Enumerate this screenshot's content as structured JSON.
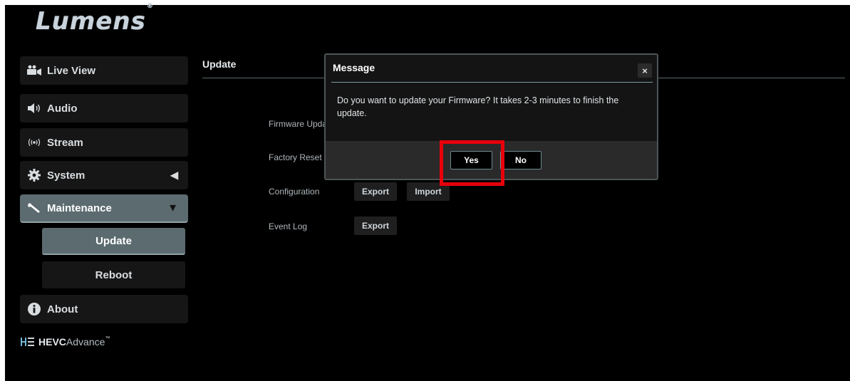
{
  "brand": {
    "logo_text": "Lumens",
    "logo_mark": "®"
  },
  "sidebar": {
    "items": [
      {
        "label": "Live View",
        "icon": "video-camera-icon"
      },
      {
        "label": "Audio",
        "icon": "speaker-icon"
      },
      {
        "label": "Stream",
        "icon": "broadcast-icon"
      },
      {
        "label": "System",
        "icon": "gear-icon",
        "arrow": "◀"
      },
      {
        "label": "Maintenance",
        "icon": "wrench-icon",
        "arrow": "▼"
      },
      {
        "label": "About",
        "icon": "info-icon"
      }
    ],
    "sub_items": [
      {
        "label": "Update",
        "active": true
      },
      {
        "label": "Reboot",
        "active": false
      }
    ],
    "partner_logo": {
      "prefix": "HEVC",
      "suffix": "Advance",
      "tm": "™"
    }
  },
  "content": {
    "title": "Update",
    "rows": [
      {
        "label": "Firmware Update"
      },
      {
        "label": "Factory Reset"
      },
      {
        "label": "Configuration",
        "buttons": [
          "Export",
          "Import"
        ]
      },
      {
        "label": "Event Log",
        "buttons": [
          "Export"
        ]
      }
    ]
  },
  "dialog": {
    "title": "Message",
    "close_glyph": "×",
    "message": "Do you want to update your Firmware? It takes 2-3 minutes to finish the update.",
    "yes_label": "Yes",
    "no_label": "No"
  },
  "annotation": {
    "highlight_color": "#e8000b",
    "target": "Yes"
  },
  "colors": {
    "active_nav": "#5c6b70",
    "background": "#000000",
    "dialog_footer": "#2a2a2a"
  }
}
